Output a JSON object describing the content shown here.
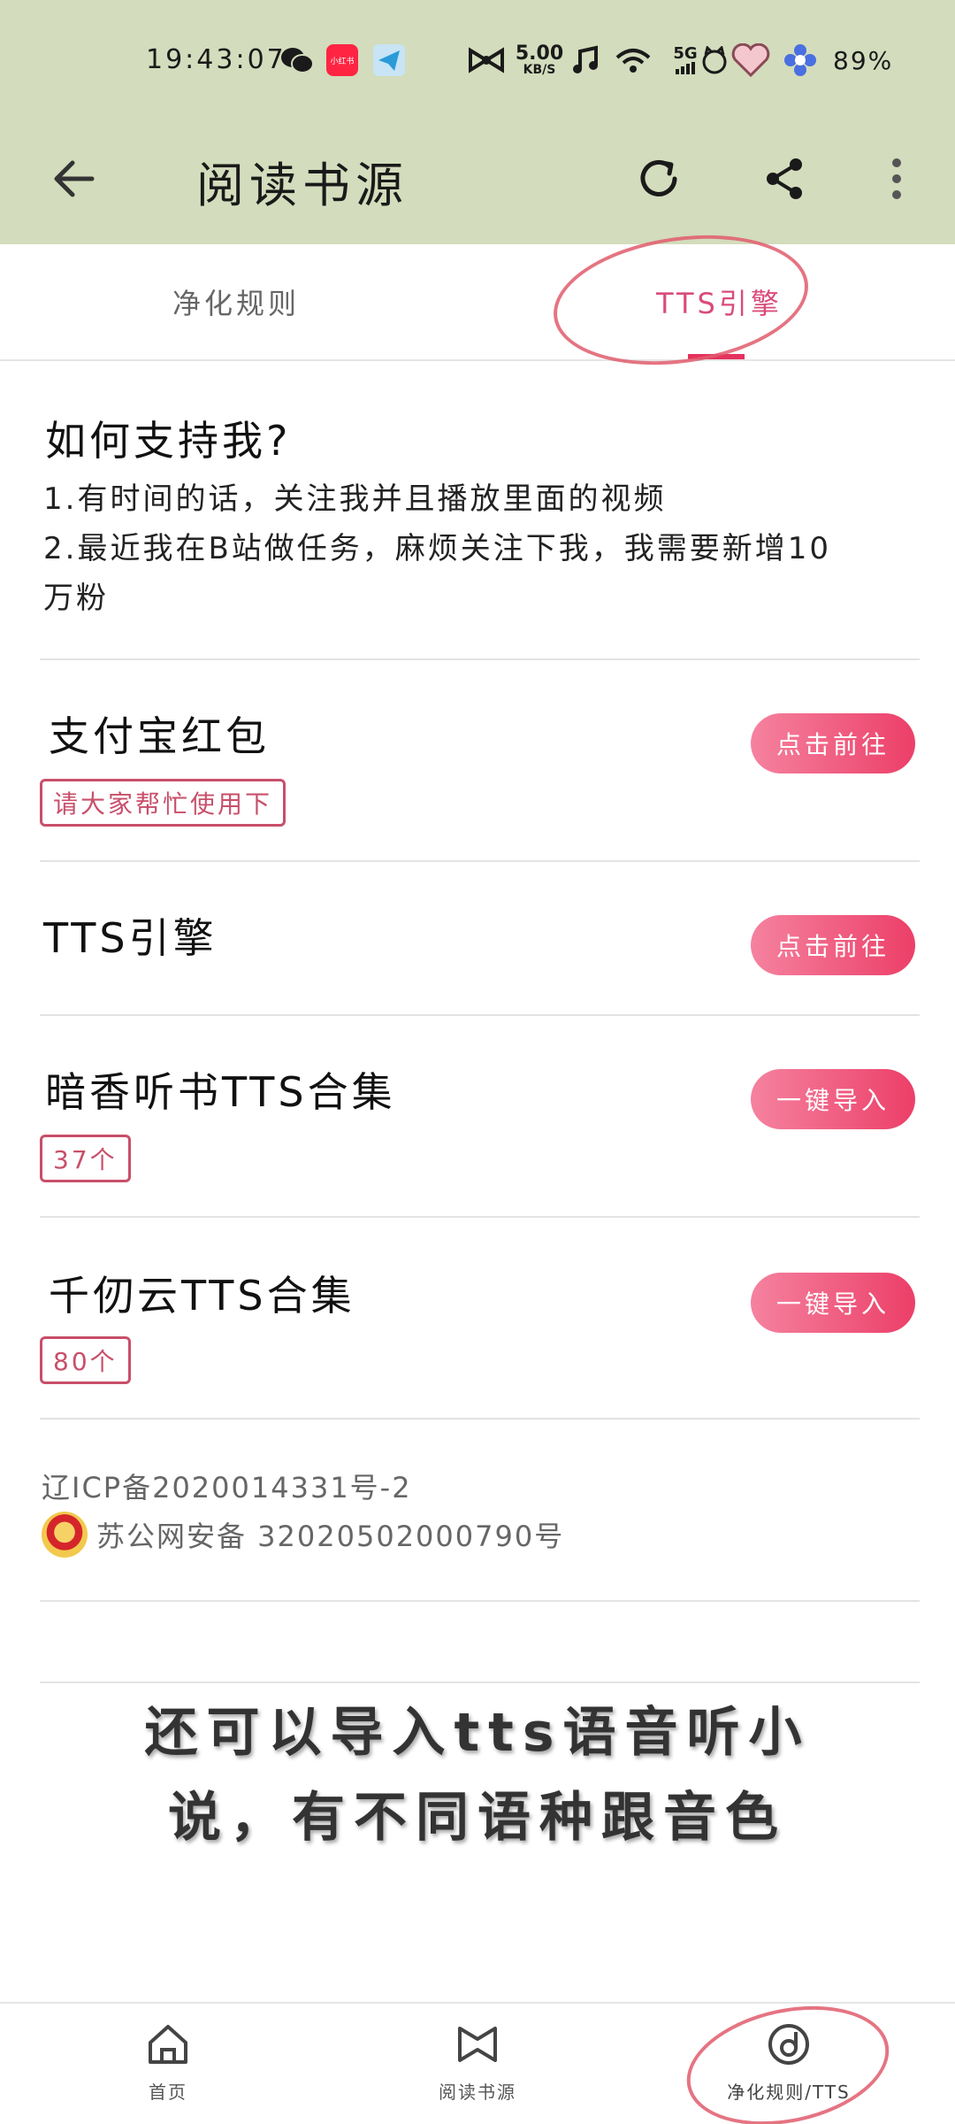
{
  "status_bar": {
    "time": "19:43:07",
    "net_speed_value": "5.00",
    "net_speed_unit": "KB/S",
    "network": "5G",
    "battery": "89%",
    "app_badge": "小红书"
  },
  "app_bar": {
    "title": "阅读书源"
  },
  "tabs": [
    {
      "label": "净化规则"
    },
    {
      "label": "TTS引擎"
    }
  ],
  "support": {
    "title": "如何支持我?",
    "lines": [
      "1.有时间的话，关注我并且播放里面的视频",
      "2.最近我在B站做任务，麻烦关注下我，我需要新增10",
      "万粉"
    ]
  },
  "items": [
    {
      "title": "支付宝红包",
      "tag": "请大家帮忙使用下",
      "button": "点击前往"
    },
    {
      "title": "TTS引擎",
      "tag": "",
      "button": "点击前往"
    },
    {
      "title": "暗香听书TTS合集",
      "tag": "37个",
      "button": "一键导入"
    },
    {
      "title": "千仞云TTS合集",
      "tag": "80个",
      "button": "一键导入"
    }
  ],
  "footer": {
    "icp": "辽ICP备2020014331号-2",
    "police": "苏公网安备 32020502000790号"
  },
  "caption": {
    "line1": "还可以导入tts语音听小",
    "line2": "说，有不同语种跟音色"
  },
  "bottom_nav": [
    {
      "label": "首页",
      "icon": "home-icon"
    },
    {
      "label": "阅读书源",
      "icon": "book-source-icon"
    },
    {
      "label": "净化规则/TTS",
      "icon": "disc-icon"
    }
  ],
  "colors": {
    "header_bg": "#d3dcbc",
    "accent": "#e5315d",
    "button_gradient_start": "#f5829f",
    "button_gradient_end": "#ec3f68",
    "tag_border": "#c84f6a"
  }
}
